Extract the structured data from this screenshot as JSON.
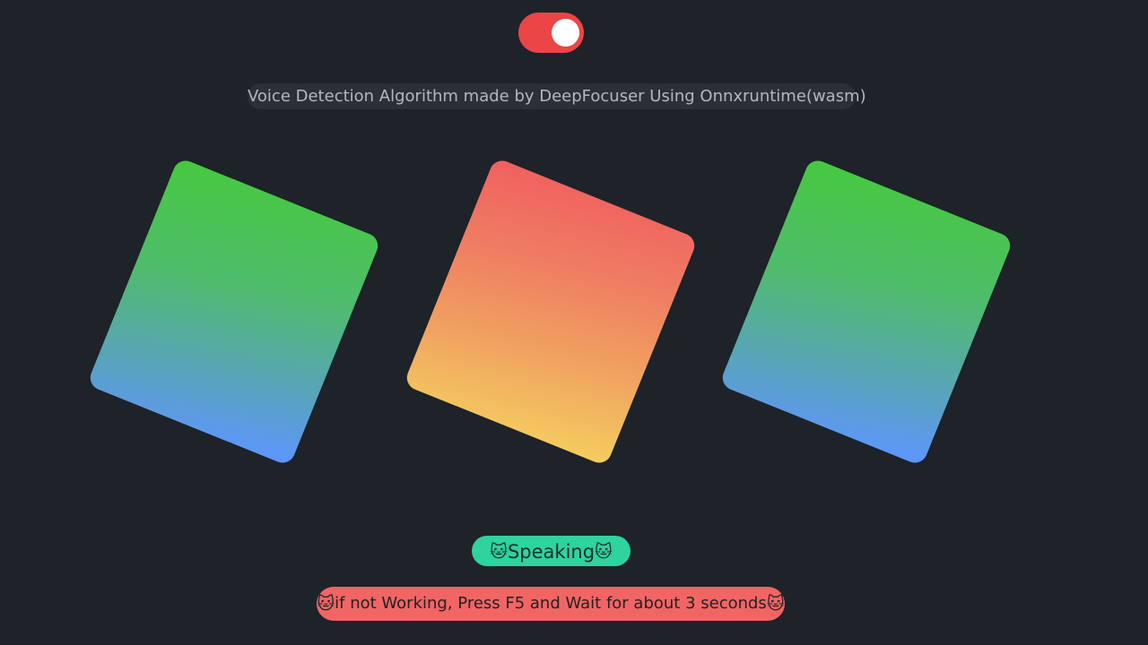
{
  "toggle": {
    "state": "on",
    "color": "#ec4545"
  },
  "subtitle": "Voice Detection Algorithm made by DeepFocuser Using Onnxruntime(wasm)",
  "squares": [
    {
      "colors": [
        "#46c93f",
        "#5e95ff"
      ]
    },
    {
      "colors": [
        "#f06060",
        "#f4cd5f"
      ]
    },
    {
      "colors": [
        "#46c93f",
        "#5e95ff"
      ]
    }
  ],
  "status": {
    "emoji": "🐱",
    "label": "Speaking",
    "color": "#2fd39d"
  },
  "hint": {
    "emoji": "🐱",
    "text": "if not Working, Press F5 and Wait for about 3 seconds",
    "color": "#f26565"
  }
}
